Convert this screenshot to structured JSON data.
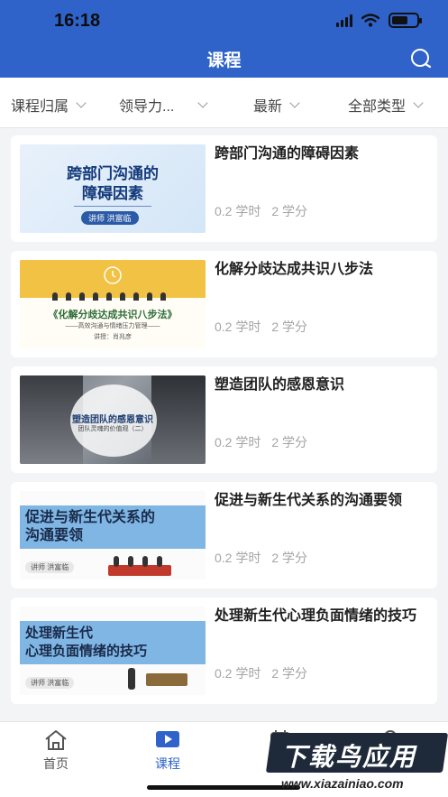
{
  "status_bar": {
    "time": "16:18",
    "battery_level": 0.65
  },
  "navbar": {
    "title": "课程",
    "search_icon": "search-icon"
  },
  "filters": [
    {
      "label": "课程归属"
    },
    {
      "label": "领导力..."
    },
    {
      "label": "最新"
    },
    {
      "label": "全部类型"
    }
  ],
  "courses": [
    {
      "title": "跨部门沟通的障碍因素",
      "hours": "0.2 学时",
      "credits": "2 学分",
      "thumb": {
        "heading_1": "跨部门沟通的",
        "heading_2": "障碍因素",
        "lecturer": "讲师 洪富临"
      }
    },
    {
      "title": "化解分歧达成共识八步法",
      "hours": "0.2 学时",
      "credits": "2 学分",
      "thumb": {
        "heading": "《化解分歧达成共识八步法》",
        "subheading": "——高效沟通与情绪压力管理——",
        "lecturer": "讲授：肖兆彦"
      }
    },
    {
      "title": "塑造团队的感恩意识",
      "hours": "0.2 学时",
      "credits": "2 学分",
      "thumb": {
        "heading": "塑造团队的感恩意识",
        "subheading": "团队灵魂的价值观（二）"
      }
    },
    {
      "title": "促进与新生代关系的沟通要领",
      "hours": "0.2 学时",
      "credits": "2 学分",
      "thumb": {
        "heading_1": "促进与新生代关系的",
        "heading_2": "沟通要领",
        "lecturer": "讲师 洪富临"
      }
    },
    {
      "title": "处理新生代心理负面情绪的技巧",
      "hours": "0.2 学时",
      "credits": "2 学分",
      "thumb": {
        "heading_1": "处理新生代",
        "heading_2": "心理负面情绪的技巧",
        "lecturer": "讲师 洪富临"
      }
    }
  ],
  "tabbar": {
    "items": [
      {
        "label": "首页",
        "icon": "home-icon"
      },
      {
        "label": "课程",
        "icon": "play-icon",
        "active": true
      },
      {
        "label": "",
        "icon": "calendar-icon"
      },
      {
        "label": "",
        "icon": "profile-icon"
      }
    ]
  },
  "watermark": {
    "line1": "下载鸟应用",
    "line2": "www.xiazainiao.com"
  },
  "colors": {
    "primary": "#2f63c9",
    "meta": "#a4a4a4",
    "background": "#f3f4f6"
  }
}
